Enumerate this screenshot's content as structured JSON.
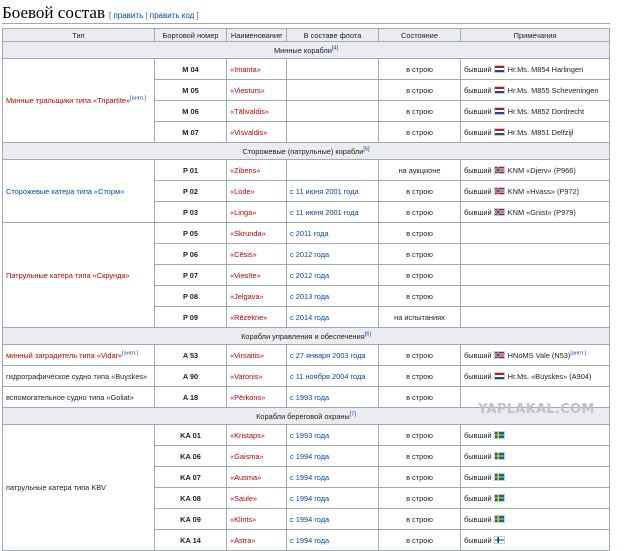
{
  "heading": {
    "title": "Боевой состав",
    "edit": "править",
    "edit_code": "править код"
  },
  "columns": [
    "Тип",
    "Бортовой номер",
    "Наименование",
    "В составе флота",
    "Состояние",
    "Примечания"
  ],
  "sections": {
    "mine": {
      "title": "Минные корабли",
      "ref": "[4]"
    },
    "patrol": {
      "title": "Сторожевые (патрульные) корабли",
      "ref": "[5]"
    },
    "support": {
      "title": "Корабли управления и обеспечения",
      "ref": "[6]"
    },
    "coast": {
      "title": "Корабли береговой охраны",
      "ref": "[7]"
    }
  },
  "types": {
    "tripartite": "Минные тральщики типа «Tripartite»",
    "tripartite_ref": "[англ.]",
    "storm": "Сторожевые катера типа «Сторм»",
    "skrunda": "Патрульные катера типа «Скрунда»",
    "vidar": "минный заградитель типа «Vidar»",
    "vidar_ref": "[англ.]",
    "buyskes": "гидрографическое судно типа «Buyskes»",
    "goliat": "вспомогательное судно типа «Goliat»",
    "kbv": "патрульные катера типа KBV"
  },
  "rows": [
    {
      "num": "M 04",
      "name": "«Imanta»",
      "date": "",
      "state": "в строю",
      "note": "бывший",
      "flag": "nl",
      "prev": "Hr.Ms. M854 Harlingen"
    },
    {
      "num": "M 05",
      "name": "«Viesturs»",
      "date": "",
      "state": "в строю",
      "note": "бывший",
      "flag": "nl",
      "prev": "Hr.Ms. M855 Scheveningen"
    },
    {
      "num": "M 06",
      "name": "«Tālivaldis»",
      "date": "",
      "state": "в строю",
      "note": "бывший",
      "flag": "nl",
      "prev": "Hr.Ms. M852 Dordrecht"
    },
    {
      "num": "M 07",
      "name": "«Visvaldis»",
      "date": "",
      "state": "в строю",
      "note": "бывший",
      "flag": "nl",
      "prev": "Hr.Ms. M851 Delfzijl"
    },
    {
      "num": "P 01",
      "name": "«Zibens»",
      "date": "",
      "state": "на аукционе",
      "note": "бывший",
      "flag": "no",
      "prev": "KNM «Djerv» (P966)"
    },
    {
      "num": "P 02",
      "name": "«Lode»",
      "date": "с 11 июня 2001 года",
      "state": "в строю",
      "note": "бывший",
      "flag": "no",
      "prev": "KNM «Hvass» (P972)"
    },
    {
      "num": "P 03",
      "name": "«Linga»",
      "date": "с 11 июня 2001 года",
      "state": "в строю",
      "note": "бывший",
      "flag": "no",
      "prev": "KNM «Gnist» (P979)"
    },
    {
      "num": "P 05",
      "name": "«Skrunda»",
      "date": "с 2011 года",
      "state": "в строю",
      "note": "",
      "flag": "",
      "prev": ""
    },
    {
      "num": "P 06",
      "name": "«Cēsis»",
      "date": "с 2012 года",
      "state": "в строю",
      "note": "",
      "flag": "",
      "prev": ""
    },
    {
      "num": "P 07",
      "name": "«Viesīte»",
      "date": "с 2012 года",
      "state": "в строю",
      "note": "",
      "flag": "",
      "prev": ""
    },
    {
      "num": "P 08",
      "name": "«Jelgava»",
      "date": "с 2013 года",
      "state": "в строю",
      "note": "",
      "flag": "",
      "prev": ""
    },
    {
      "num": "P 09",
      "name": "«Rēzekne»",
      "date": "с 2014 года",
      "state": "на испытаниях",
      "note": "",
      "flag": "",
      "prev": ""
    },
    {
      "num": "A 53",
      "name": "«Virsaitis»",
      "date": "с 27 января 2003 года",
      "state": "в строю",
      "note": "бывший",
      "flag": "no",
      "prev": "HNoMS Vale (N53)",
      "prev_ref": "[англ.]"
    },
    {
      "num": "A 90",
      "name": "«Varonis»",
      "date": "с 11 ноября 2004 года",
      "state": "в строю",
      "note": "бывший",
      "flag": "nl",
      "prev": "Hr.Ms. «Buyskes» (A904)"
    },
    {
      "num": "A 18",
      "name": "«Pērkons»",
      "date": "с 1993 года",
      "state": "в строю",
      "note": "",
      "flag": "",
      "prev": ""
    },
    {
      "num": "KA 01",
      "name": "«Kristaps»",
      "date": "с 1993 года",
      "state": "в строю",
      "note": "бывший",
      "flag": "se",
      "prev": ""
    },
    {
      "num": "KA 06",
      "name": "«Gaisma»",
      "date": "с 1994 года",
      "state": "в строю",
      "note": "бывший",
      "flag": "se",
      "prev": ""
    },
    {
      "num": "KA 07",
      "name": "«Ausma»",
      "date": "с 1994 года",
      "state": "в строю",
      "note": "бывший",
      "flag": "se",
      "prev": ""
    },
    {
      "num": "KA 08",
      "name": "«Saule»",
      "date": "с 1994 года",
      "state": "в строю",
      "note": "бывший",
      "flag": "se",
      "prev": ""
    },
    {
      "num": "KA 09",
      "name": "«Klints»",
      "date": "с 1994 года",
      "state": "в строю",
      "note": "бывший",
      "flag": "se",
      "prev": ""
    },
    {
      "num": "KA 14",
      "name": "«Astra»",
      "date": "с 1994 года",
      "state": "в строю",
      "note": "бывший",
      "flag": "fi",
      "prev": ""
    }
  ],
  "watermark": "YAPLAKAL.COM"
}
